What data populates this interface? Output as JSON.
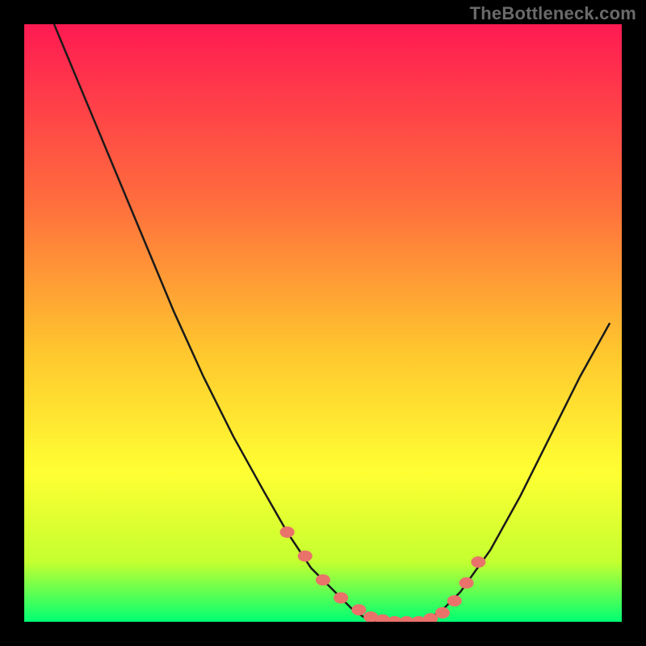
{
  "watermark": "TheBottleneck.com",
  "colors": {
    "top": "#ff1a52",
    "mid1": "#ff6e3d",
    "mid2": "#ffc72e",
    "mid3": "#ffff33",
    "mid4": "#c4ff2f",
    "bottom": "#00ff73",
    "curve": "#1a1a1a",
    "marker": "#e9726a",
    "frame": "#000000"
  },
  "chart_data": {
    "type": "line",
    "title": "",
    "xlabel": "",
    "ylabel": "",
    "xlim": [
      0,
      100
    ],
    "ylim": [
      0,
      100
    ],
    "series": [
      {
        "name": "curve",
        "x": [
          5,
          10,
          15,
          20,
          25,
          30,
          35,
          40,
          44,
          48,
          52,
          55,
          58,
          61,
          64,
          67,
          70,
          73,
          78,
          83,
          88,
          93,
          98
        ],
        "y": [
          100,
          88,
          76,
          64,
          52,
          41,
          31,
          22,
          15,
          9,
          5,
          2,
          0,
          0,
          0,
          0,
          2,
          5,
          12,
          21,
          31,
          41,
          50
        ]
      }
    ],
    "markers": {
      "name": "dots",
      "x": [
        44,
        47,
        50,
        53,
        56,
        58,
        60,
        62,
        64,
        66,
        68,
        70,
        72,
        74,
        76
      ],
      "y": [
        15,
        11,
        7,
        4,
        2,
        0.8,
        0.3,
        0,
        0,
        0,
        0.5,
        1.5,
        3.5,
        6.5,
        10
      ]
    }
  }
}
